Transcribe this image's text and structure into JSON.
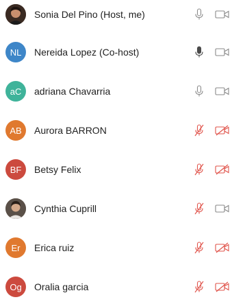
{
  "participants": [
    {
      "name": "Sonia Del Pino (Host, me)",
      "initials": "",
      "avatar_type": "photo",
      "avatar_color": "#6b4a3a",
      "mic": "on",
      "video": "off"
    },
    {
      "name": "Nereida Lopez (Co-host)",
      "initials": "NL",
      "avatar_type": "initials",
      "avatar_color": "#3e86c8",
      "mic": "on-dark",
      "video": "off"
    },
    {
      "name": "adriana Chavarria",
      "initials": "aC",
      "avatar_type": "initials",
      "avatar_color": "#3fb39a",
      "mic": "on",
      "video": "off"
    },
    {
      "name": "Aurora BARRON",
      "initials": "AB",
      "avatar_type": "initials",
      "avatar_color": "#e0792f",
      "mic": "muted",
      "video": "stopped"
    },
    {
      "name": "Betsy Felix",
      "initials": "BF",
      "avatar_type": "initials",
      "avatar_color": "#cc4a3e",
      "mic": "muted",
      "video": "stopped"
    },
    {
      "name": "Cynthia Cuprill",
      "initials": "",
      "avatar_type": "photo",
      "avatar_color": "#7a6a5e",
      "mic": "muted",
      "video": "off"
    },
    {
      "name": "Erica ruiz",
      "initials": "Er",
      "avatar_type": "initials",
      "avatar_color": "#e0792f",
      "mic": "muted",
      "video": "stopped"
    },
    {
      "name": "Oralia garcia",
      "initials": "Og",
      "avatar_type": "initials",
      "avatar_color": "#cc4a3e",
      "mic": "muted",
      "video": "stopped"
    }
  ],
  "icons": {
    "mic": "microphone-icon",
    "mic_muted": "microphone-muted-icon",
    "video": "video-camera-icon",
    "video_stopped": "video-camera-stopped-icon"
  },
  "colors": {
    "muted_red": "#e0534a",
    "icon_gray": "#8a8a8a",
    "icon_dark": "#4a4a4a"
  }
}
